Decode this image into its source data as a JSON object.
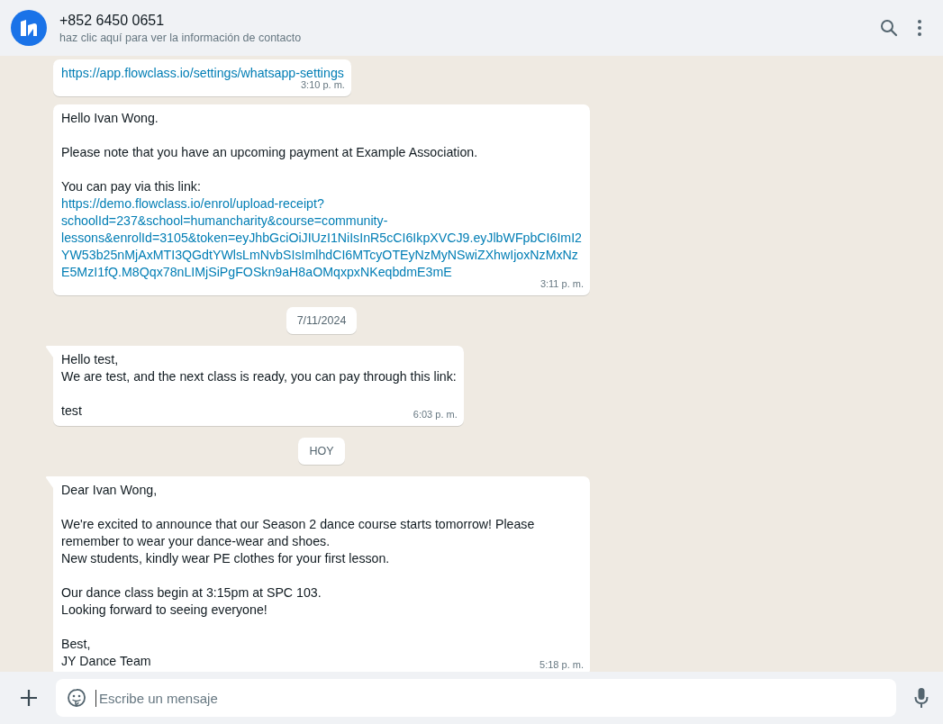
{
  "header": {
    "title": "+852 6450 0651",
    "subtitle": "haz clic aquí para ver la información de contacto"
  },
  "messages": [
    {
      "kind": "message",
      "tail": false,
      "time": "3:10 p. m.",
      "paragraphs": [
        [
          {
            "kind": "link",
            "text": "https://app.flowclass.io/settings/whatsapp-settings"
          }
        ]
      ]
    },
    {
      "kind": "message",
      "tail": false,
      "time": "3:11 p. m.",
      "paragraphs": [
        [
          {
            "kind": "text",
            "text": "Hello Ivan Wong."
          }
        ],
        [
          {
            "kind": "text",
            "text": "Please note that you have an upcoming payment at Example Association."
          }
        ],
        [
          {
            "kind": "text",
            "text": "You can pay via this link:"
          },
          {
            "kind": "link",
            "text": "https://demo.flowclass.io/enrol/upload-receipt?schoolId=237&school=humancharity&course=community-lessons&enrolId=3105&token=eyJhbGciOiJIUzI1NiIsInR5cCI6IkpXVCJ9.eyJlbWFpbCI6ImI2YW53b25nMjAxMTI3QGdtYWlsLmNvbSIsImlhdCI6MTcyOTEyNzMyNSwiZXhwIjoxNzMxNzE5MzI1fQ.M8Qqx78nLIMjSiPgFOSkn9aH8aOMqxpxNKeqbdmE3mE"
          }
        ]
      ]
    },
    {
      "kind": "date",
      "label": "7/11/2024"
    },
    {
      "kind": "message",
      "tail": true,
      "time": "6:03 p. m.",
      "paragraphs": [
        [
          {
            "kind": "text",
            "text": "Hello test,"
          },
          {
            "kind": "text",
            "text": "We are test, and the next class is ready, you can pay through this link:"
          }
        ],
        [
          {
            "kind": "text",
            "text": "test"
          }
        ]
      ]
    },
    {
      "kind": "date",
      "label": "HOY"
    },
    {
      "kind": "message",
      "tail": true,
      "time": "5:18 p. m.",
      "paragraphs": [
        [
          {
            "kind": "text",
            "text": "Dear Ivan Wong,"
          }
        ],
        [
          {
            "kind": "text",
            "text": "We're excited to announce that our Season 2 dance course starts tomorrow! Please remember to wear your dance-wear and shoes."
          },
          {
            "kind": "text",
            "text": "New students, kindly wear PE clothes for your first lesson."
          }
        ],
        [
          {
            "kind": "text",
            "text": "Our dance class begin at 3:15pm at SPC 103."
          },
          {
            "kind": "text",
            "text": "Looking forward to seeing everyone!"
          }
        ],
        [
          {
            "kind": "text",
            "text": "Best,"
          },
          {
            "kind": "text",
            "text": "JY Dance Team"
          }
        ]
      ]
    }
  ],
  "composer": {
    "placeholder": "Escribe un mensaje"
  }
}
